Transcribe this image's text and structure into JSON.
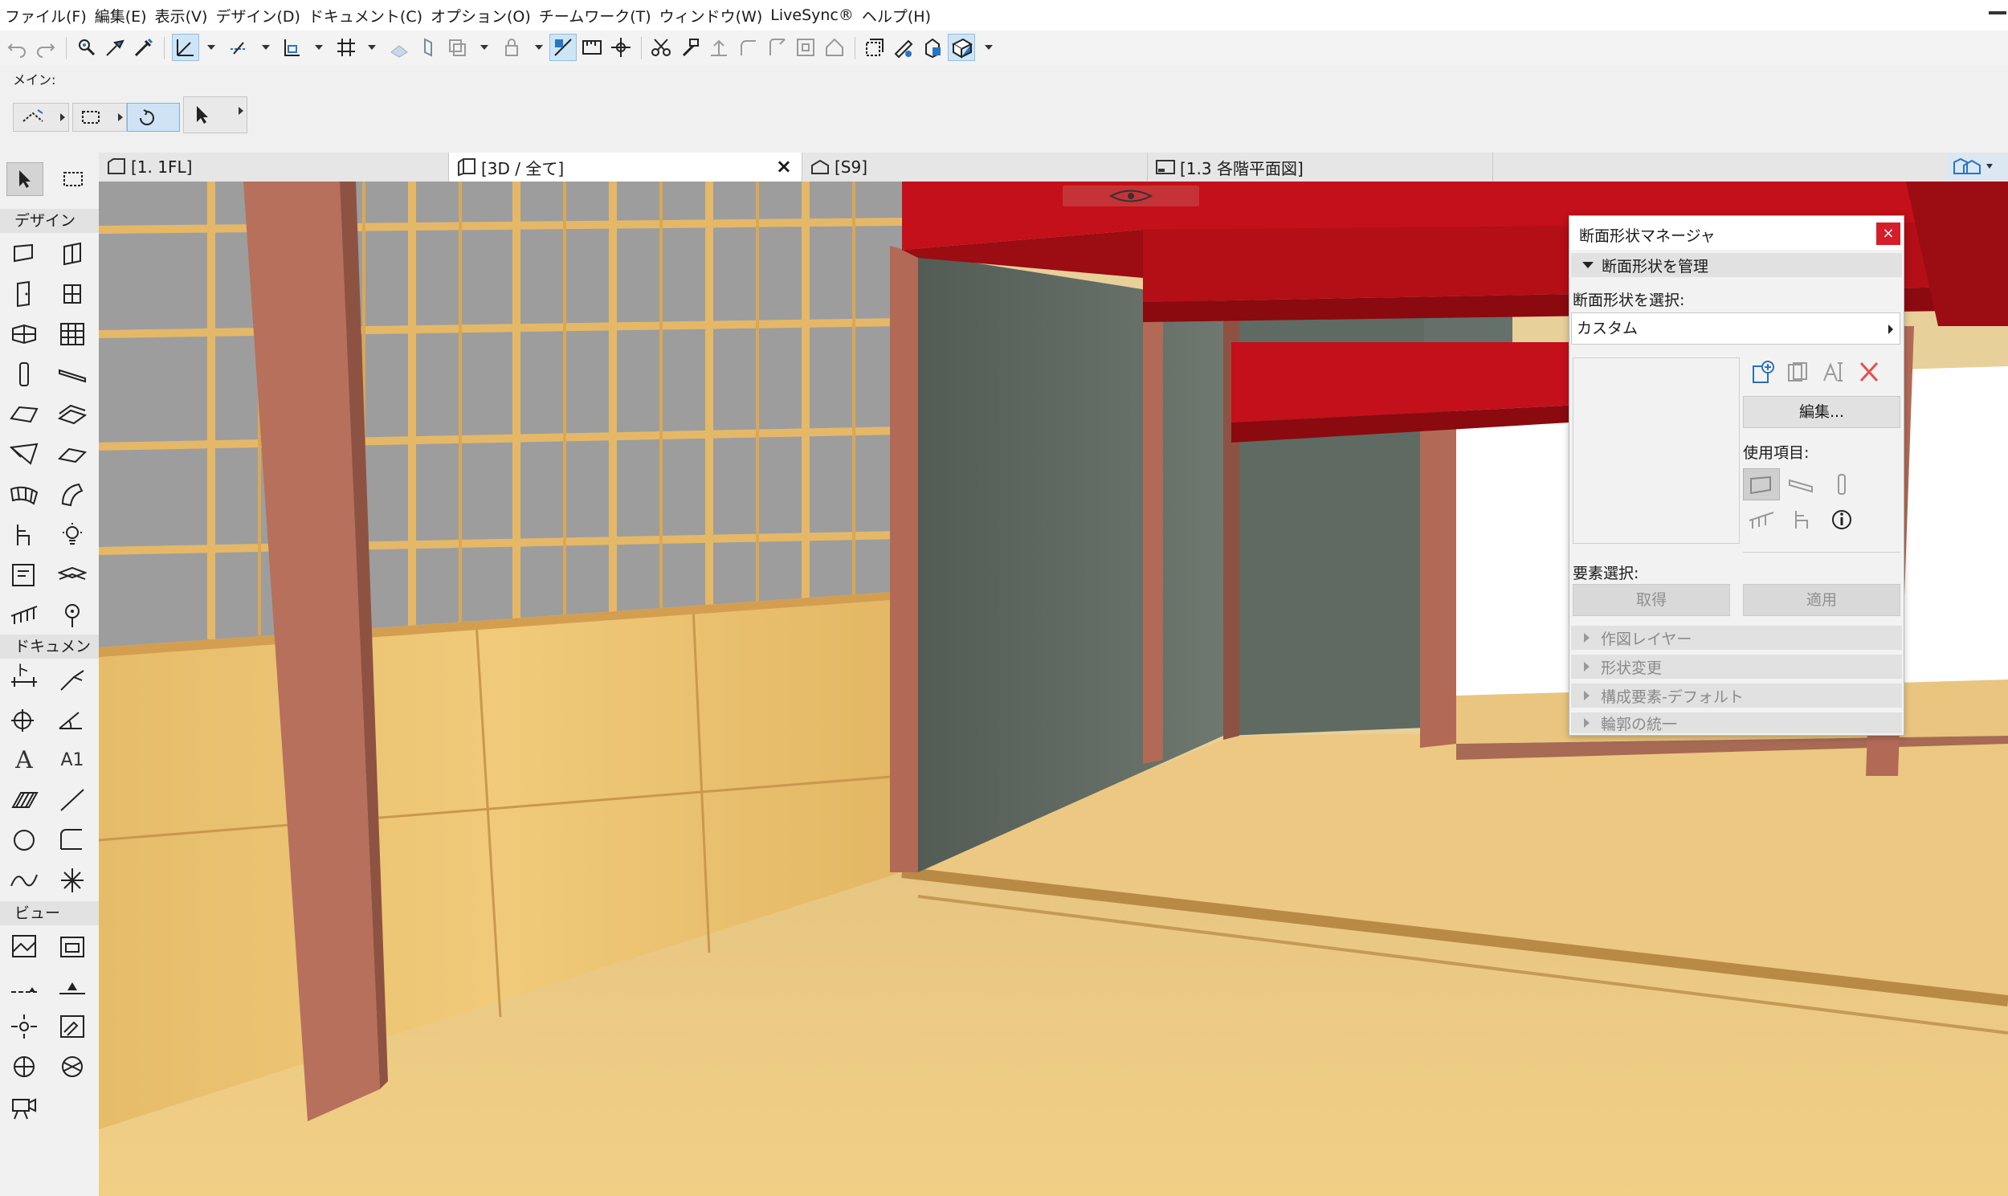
{
  "menu": [
    "ファイル(F)",
    "編集(E)",
    "表示(V)",
    "デザイン(D)",
    "ドキュメント(C)",
    "オプション(O)",
    "チームワーク(T)",
    "ウィンドウ(W)",
    "LiveSync®",
    "ヘルプ(H)"
  ],
  "infobox": {
    "label": "メイン:"
  },
  "toolbox": {
    "sections": {
      "design": "デザイン",
      "document": "ドキュメント",
      "view": "ビュー"
    },
    "document_text_tool": "A",
    "document_label_tool": "A1"
  },
  "tabs": [
    {
      "label": "[1. 1FL]",
      "icon": "floorplan-icon"
    },
    {
      "label": "[3D / 全て]",
      "icon": "3d-window-icon",
      "active": true,
      "close": "×"
    },
    {
      "label": "[S9]",
      "icon": "section-icon"
    },
    {
      "label": "[1.3 各階平面図]",
      "icon": "layout-icon"
    }
  ],
  "palette": {
    "title": "断面形状マネージャ",
    "close": "×",
    "manage_header": "断面形状を管理",
    "select_label": "断面形状を選択:",
    "select_value": "カスタム",
    "edit_button": "編集...",
    "used_label": "使用項目:",
    "element_select_label": "要素選択:",
    "get_button": "取得",
    "apply_button": "適用",
    "collapsed_sections": [
      "作図レイヤー",
      "形状変更",
      "構成要素-デフォルト",
      "輪郭の統一"
    ]
  },
  "colors": {
    "accent_red": "#c3101a",
    "close_red": "#d41e2a",
    "wood": "#e2b865",
    "post": "#b26a57",
    "concrete": "#5f6960",
    "shoji_glass": "#9a9a9a",
    "selection_blue": "#cde5f7"
  }
}
